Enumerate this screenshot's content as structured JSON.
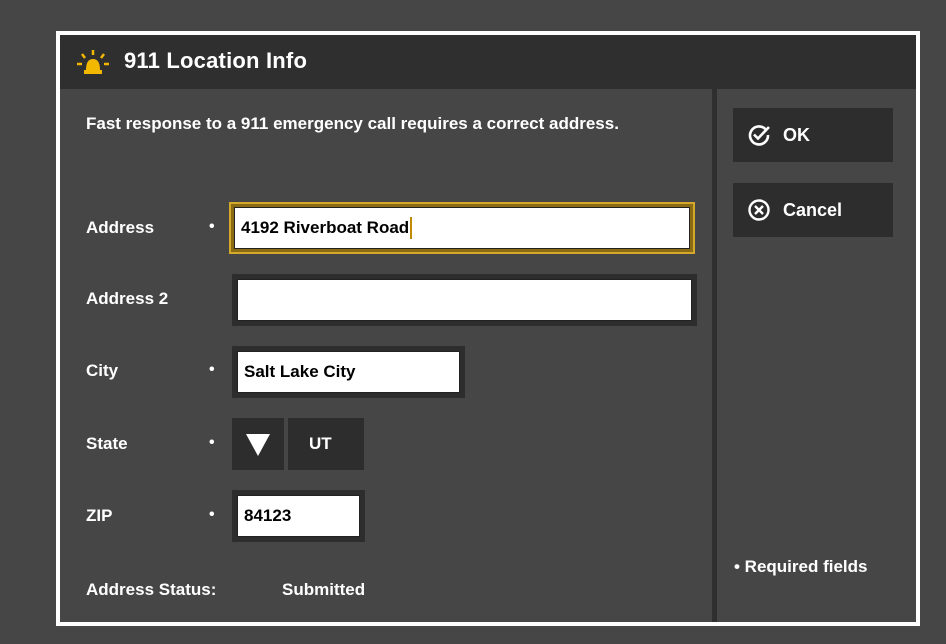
{
  "dialog": {
    "title": "911 Location Info",
    "title_icon": "siren-icon",
    "intro": "Fast response to a 911 emergency call requires a correct address."
  },
  "form": {
    "required_marker": "•",
    "address": {
      "label": "Address",
      "value": "4192 Riverboat Road",
      "required": true
    },
    "address2": {
      "label": "Address 2",
      "value": "",
      "required": false
    },
    "city": {
      "label": "City",
      "value": "Salt Lake City",
      "required": true
    },
    "state": {
      "label": "State",
      "value": "UT",
      "required": true,
      "dropdown_icon": "triangle-down-icon"
    },
    "zip": {
      "label": "ZIP",
      "value": "84123",
      "required": true
    },
    "status": {
      "label": "Address Status:",
      "value": "Submitted"
    }
  },
  "actions": {
    "ok": {
      "label": "OK",
      "icon": "check-circle-icon"
    },
    "cancel": {
      "label": "Cancel",
      "icon": "x-circle-icon"
    }
  },
  "required_note": "• Required fields",
  "colors": {
    "background": "#464646",
    "panel": "#2d2d2d",
    "focus_border": "#d4a82a",
    "siren": "#f2b800"
  }
}
